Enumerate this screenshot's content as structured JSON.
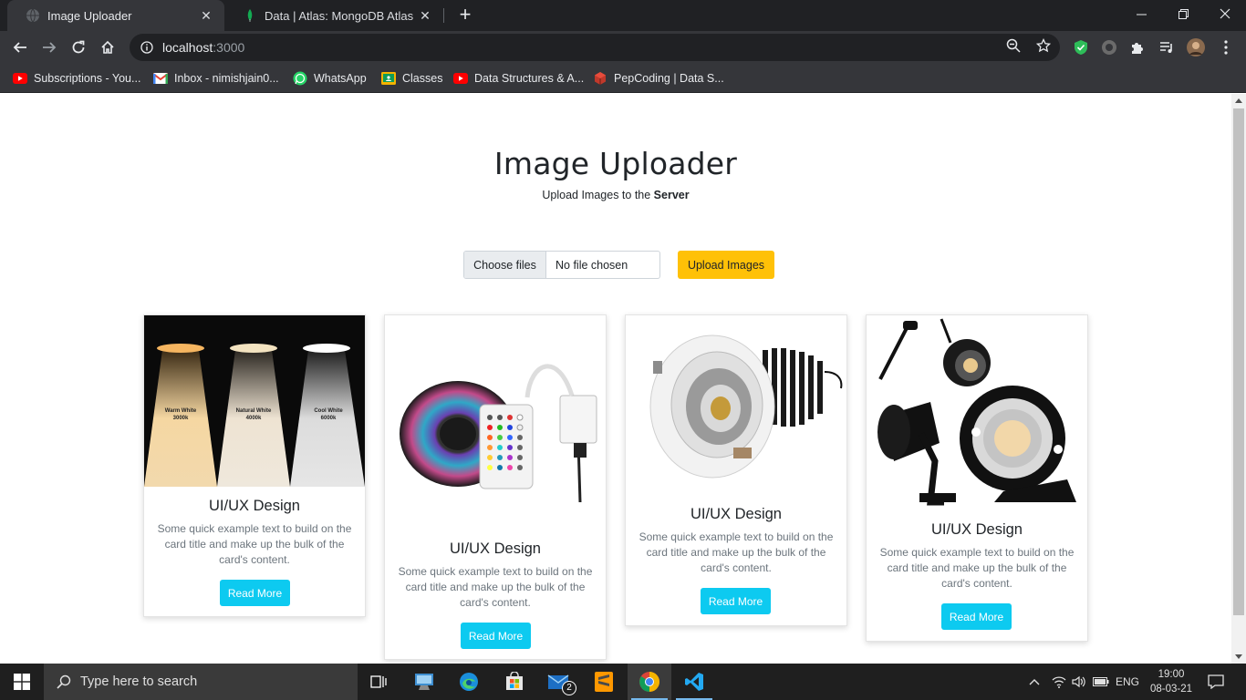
{
  "browser": {
    "tabs": [
      {
        "title": "Image Uploader",
        "icon": "globe-icon",
        "active": true
      },
      {
        "title": "Data | Atlas: MongoDB Atlas",
        "icon": "mongodb-leaf-icon",
        "active": false
      }
    ],
    "url_host": "localhost",
    "url_port": ":3000",
    "bookmarks": [
      {
        "label": "Subscriptions - You...",
        "icon": "youtube-icon"
      },
      {
        "label": "Inbox - nimishjain0...",
        "icon": "gmail-icon"
      },
      {
        "label": "WhatsApp",
        "icon": "whatsapp-icon"
      },
      {
        "label": "Classes",
        "icon": "google-classroom-icon"
      },
      {
        "label": "Data Structures & A...",
        "icon": "youtube-icon"
      },
      {
        "label": "PepCoding | Data S...",
        "icon": "pepcoding-icon"
      }
    ]
  },
  "page": {
    "title": "Image Uploader",
    "subtitle_prefix": "Upload Images to the ",
    "subtitle_bold": "Server",
    "file_button": "Choose files",
    "file_status": "No file chosen",
    "upload_button": "Upload Images",
    "cards": [
      {
        "title": "UI/UX Design",
        "text": "Some quick example text to build on the card title and make up the bulk of the card's content.",
        "button": "Read More",
        "image": "warm-neutral-cool-white-lights-image",
        "labels": [
          "Warm White",
          "3000k",
          "Natural White",
          "4000k",
          "Cool White",
          "6000k"
        ]
      },
      {
        "title": "UI/UX Design",
        "text": "Some quick example text to build on the card title and make up the bulk of the card's content.",
        "button": "Read More",
        "image": "rgb-led-strip-with-remote-image"
      },
      {
        "title": "UI/UX Design",
        "text": "Some quick example text to build on the card title and make up the bulk of the card's content.",
        "button": "Read More",
        "image": "recessed-cob-downlight-image"
      },
      {
        "title": "UI/UX Design",
        "text": "Some quick example text to build on the card title and make up the bulk of the card's content.",
        "button": "Read More",
        "image": "garden-spike-spotlights-image"
      }
    ]
  },
  "taskbar": {
    "search_placeholder": "Type here to search",
    "mail_badge": "2",
    "language": "ENG",
    "time": "19:00",
    "date": "08-03-21"
  },
  "colors": {
    "upload_button": "#ffc107",
    "read_more_button": "#0dcaf0",
    "chrome_dark": "#202124",
    "chrome_toolbar": "#35363a"
  }
}
